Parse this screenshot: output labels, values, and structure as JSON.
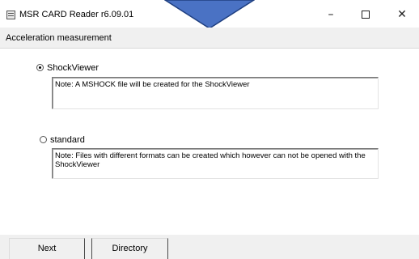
{
  "window": {
    "title": "MSR  CARD Reader r6.09.01",
    "minimize_glyph": "–",
    "close_glyph": "✕"
  },
  "header": {
    "title": "Acceleration measurement"
  },
  "options": [
    {
      "label": "ShockViewer",
      "selected": true,
      "note": "Note: A MSHOCK file will be created for the ShockViewer"
    },
    {
      "label": "standard",
      "selected": false,
      "note": "Note: Files with different formats can be created which however can not be opened with the ShockViewer"
    }
  ],
  "footer": {
    "next_label": "Next",
    "directory_label": "Directory"
  },
  "colors": {
    "chevron_fill": "#4a72c4",
    "chevron_stroke": "#1f3f80",
    "panel_background": "#f0f0f0",
    "content_background": "#ffffff"
  },
  "icons": {
    "app_icon": "sd-card-icon",
    "overlay": "chevron-down-icon"
  }
}
